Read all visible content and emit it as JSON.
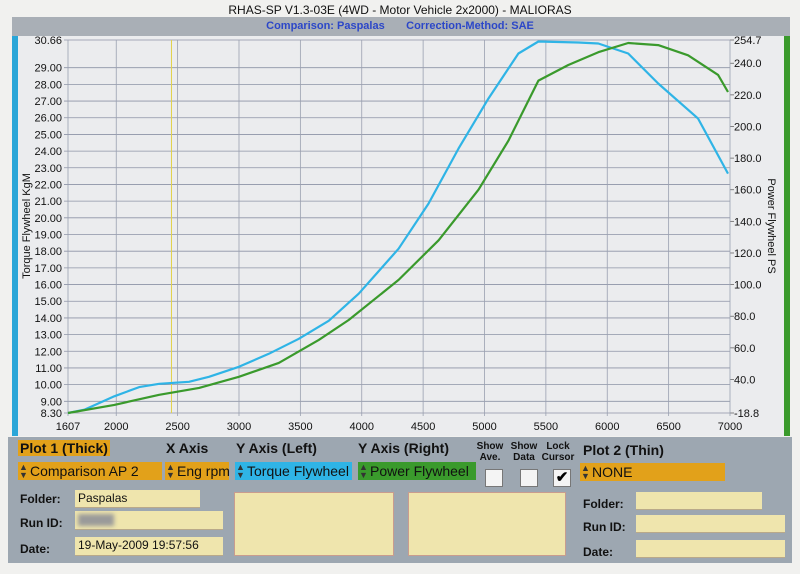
{
  "header": {
    "title": "RHAS-SP V1.3-03E  (4WD - Motor Vehicle 2x2000) - MALIORAS",
    "comparison": "Comparison: Paspalas",
    "correction": "Correction-Method: SAE"
  },
  "colors": {
    "torque": "#2fb4e6",
    "power": "#3a9a2c",
    "cursor": "#e2d24a",
    "plot_label": "#e2a11a"
  },
  "chart_data": {
    "type": "line",
    "title": "RHAS-SP V1.3-03E  (4WD - Motor Vehicle 2x2000) - MALIORAS",
    "xlabel": "Eng rpm",
    "ylabel": "Torque Flywheel KgM",
    "y2label": "Power Flywheel PS",
    "xlim": [
      1607,
      7000
    ],
    "ylim": [
      8.3,
      30.66
    ],
    "y2lim": [
      18.8,
      254.7
    ],
    "x_ticks": [
      "1607",
      "2000",
      "2500",
      "3000",
      "3500",
      "4000",
      "4500",
      "5000",
      "5500",
      "6000",
      "6500",
      "7000"
    ],
    "y_ticks": [
      "30.66",
      "29.00",
      "28.00",
      "27.00",
      "26.00",
      "25.00",
      "24.00",
      "23.00",
      "22.00",
      "21.00",
      "20.00",
      "19.00",
      "18.00",
      "17.00",
      "16.00",
      "15.00",
      "14.00",
      "13.00",
      "12.00",
      "11.00",
      "10.00",
      "9.00",
      "8.30"
    ],
    "y2_ticks": [
      "254.7",
      "240.0",
      "220.0",
      "200.0",
      "180.0",
      "160.0",
      "140.0",
      "120.0",
      "100.0",
      "80.0",
      "60.0",
      "40.0",
      "-18.8"
    ],
    "cursor_rpm": 2450,
    "grid": true,
    "series": [
      {
        "name": "Torque Flywheel",
        "axis": "left",
        "x": [
          1607,
          1740,
          1984,
          2187,
          2350,
          2593,
          2756,
          2999,
          3243,
          3487,
          3731,
          3975,
          4300,
          4544,
          4788,
          5032,
          5276,
          5439,
          5764,
          5927,
          6171,
          6415,
          6740,
          6984
        ],
        "y": [
          8.3,
          8.5,
          9.3,
          9.85,
          10.05,
          10.17,
          10.47,
          11.07,
          11.85,
          12.75,
          13.83,
          15.45,
          18.15,
          20.85,
          24.15,
          27.15,
          29.85,
          30.57,
          30.51,
          30.45,
          29.85,
          28.05,
          25.95,
          22.65
        ]
      },
      {
        "name": "Power Flywheel",
        "axis": "right",
        "x": [
          1607,
          1984,
          2350,
          2675,
          2999,
          3324,
          3650,
          3894,
          4300,
          4626,
          4951,
          5195,
          5439,
          5683,
          5927,
          6171,
          6415,
          6659,
          6903,
          6984
        ],
        "y": [
          18.8,
          23.9,
          30.3,
          34.7,
          41.7,
          50.5,
          65.0,
          77.6,
          103.0,
          128.0,
          160.0,
          191.0,
          229.0,
          238.9,
          247.0,
          252.8,
          251.5,
          245.0,
          232.6,
          221.8
        ]
      }
    ]
  },
  "panel": {
    "plot1_label": "Plot 1 (Thick)",
    "xaxis_label": "X Axis",
    "yleft_label": "Y Axis (Left)",
    "yright_label": "Y Axis (Right)",
    "show_ave_label": "Show Ave.",
    "show_data_label": "Show Data",
    "lock_cursor_label": "Lock Cursor",
    "plot2_label": "Plot 2 (Thin)",
    "plot1_value": "Comparison AP 2",
    "xaxis_value": "Eng rpm",
    "yleft_value": "Torque Flywheel",
    "yright_value": "Power Flywheel",
    "plot2_value": "NONE",
    "show_ave_checked": false,
    "show_data_checked": false,
    "lock_cursor_checked": true,
    "check_mark": "✔",
    "folder_label": "Folder:",
    "runid_label": "Run ID:",
    "date_label": "Date:",
    "plot1_folder": "Paspalas",
    "plot1_date": "19-May-2009  19:57:56"
  }
}
